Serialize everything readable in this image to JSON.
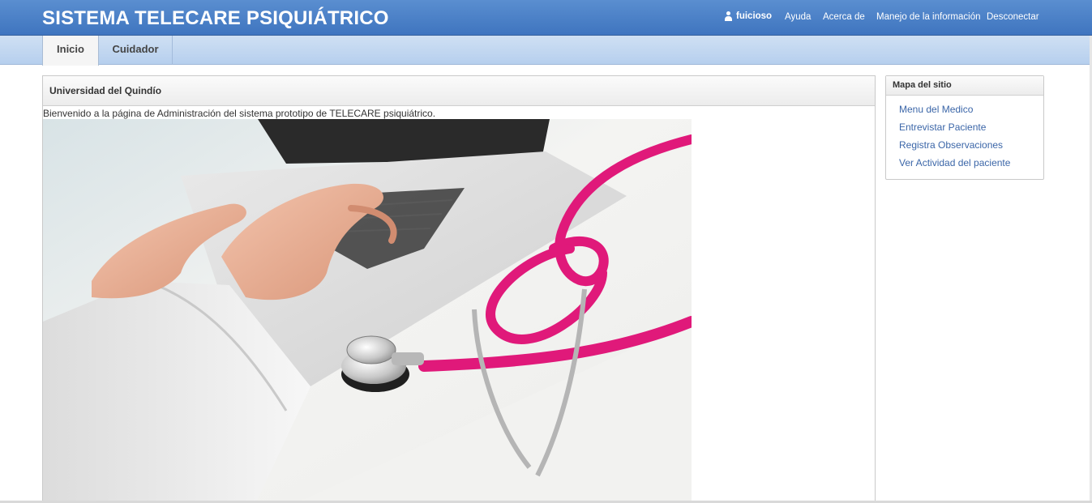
{
  "header": {
    "title": "SISTEMA TELECARE PSIQUIÁTRICO",
    "user": "fuicioso",
    "nav": [
      "Ayuda",
      "Acerca de",
      "Manejo de la información",
      "Desconectar"
    ]
  },
  "tabs": [
    "Inicio",
    "Cuidador"
  ],
  "main": {
    "title": "Universidad del Quindío",
    "welcome": "Bienvenido a la página de Administración del sistema prototipo de TELECARE psiquiátrico."
  },
  "sidebar": {
    "title": "Mapa del sitio",
    "items": [
      "Menu del Medico",
      "Entrevistar Paciente",
      "Registra Observaciones",
      "Ver Actividad del paciente"
    ]
  },
  "colors": {
    "header_blue": "#4a7fc6",
    "link": "#3b66a8",
    "stethoscope_pink": "#e0197a"
  },
  "icons": [
    "user-icon"
  ]
}
